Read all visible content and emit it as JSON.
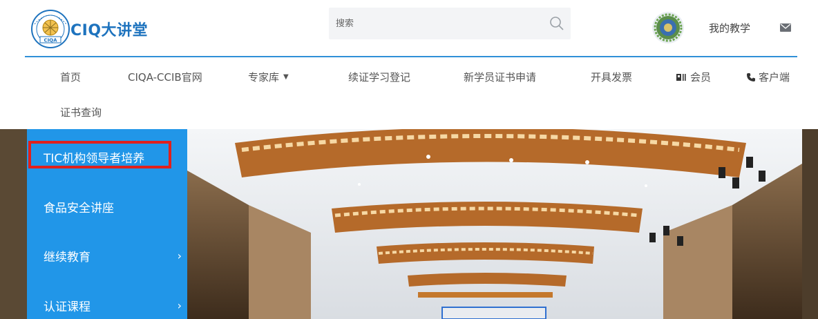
{
  "header": {
    "logo_text": "CIQ大讲堂",
    "search_placeholder": "搜索",
    "user_link": "我的教学"
  },
  "nav": {
    "items": [
      {
        "label": "首页"
      },
      {
        "label": "CIQA-CCIB官网"
      },
      {
        "label": "专家库",
        "has_dropdown": true
      },
      {
        "label": "续证学习登记"
      },
      {
        "label": "新学员证书申请"
      },
      {
        "label": "开具发票"
      },
      {
        "label": "会员",
        "icon": "vip-card-icon"
      },
      {
        "label": "客户端",
        "icon": "phone-icon"
      },
      {
        "label": "证书查询"
      }
    ]
  },
  "side_menu": {
    "items": [
      {
        "label": "TIC机构领导者培养",
        "highlighted": true
      },
      {
        "label": "食品安全讲座"
      },
      {
        "label": "继续教育",
        "has_submenu": true
      },
      {
        "label": "认证课程",
        "has_submenu": true
      }
    ]
  },
  "colors": {
    "brand_blue": "#1e73be",
    "side_menu_bg": "#2196e8",
    "highlight_border": "#e0201c",
    "header_rule": "#2f8fd8"
  }
}
